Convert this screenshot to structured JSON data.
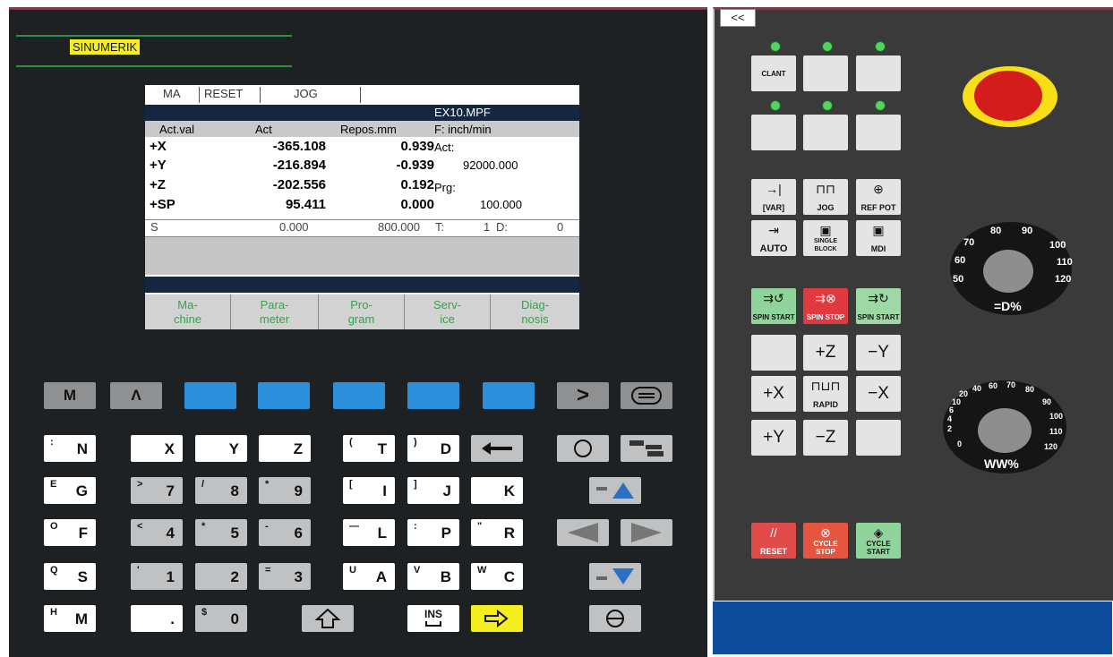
{
  "brand": "SINUMERIK",
  "screen": {
    "status": {
      "area": "MA",
      "channel": "RESET",
      "mode": "JOG"
    },
    "program_name": "EX10.MPF",
    "headers": {
      "col1": "Act.val",
      "col2": "Act",
      "col3": "Repos.mm",
      "col4": "F: inch/min"
    },
    "axes": [
      {
        "name": "+X",
        "act": "-365.108",
        "repos": "0.939"
      },
      {
        "name": "+Y",
        "act": "-216.894",
        "repos": "-0.939"
      },
      {
        "name": "+Z",
        "act": "-202.556",
        "repos": "0.192"
      },
      {
        "name": "+SP",
        "act": "95.411",
        "repos": "0.000"
      }
    ],
    "feed": {
      "act_label": "Act:",
      "act_value": "92000.000",
      "prg_label": "Prg:",
      "prg_value": "100.000"
    },
    "spindle_row": {
      "label": "S",
      "act": "0.000",
      "set": "800.000",
      "tool_label": "T:",
      "tool": "1",
      "d_label": "D:",
      "d": "0"
    },
    "softkeys": [
      {
        "line1": "Ma-",
        "line2": "chine"
      },
      {
        "line1": "Para-",
        "line2": "meter"
      },
      {
        "line1": "Pro-",
        "line2": "gram"
      },
      {
        "line1": "Serv-",
        "line2": "ice"
      },
      {
        "line1": "Diag-",
        "line2": "nosis"
      }
    ]
  },
  "keyboard": {
    "top_row": {
      "m": "M",
      "caret": "Λ",
      "next": ">"
    },
    "rows": [
      [
        {
          "sup": ":",
          "main": "N"
        },
        {
          "sup": "",
          "main": "X"
        },
        {
          "sup": "",
          "main": "Y"
        },
        {
          "sup": "",
          "main": "Z"
        },
        {
          "sup": "(",
          "main": "T"
        },
        {
          "sup": ")",
          "main": "D"
        }
      ],
      [
        {
          "sup": "E",
          "main": "G"
        },
        {
          "sup": ">",
          "main": "7"
        },
        {
          "sup": "/",
          "main": "8"
        },
        {
          "sup": "*",
          "main": "9"
        },
        {
          "sup": "[",
          "main": "I"
        },
        {
          "sup": "]",
          "main": "J"
        },
        {
          "sup": "",
          "main": "K"
        }
      ],
      [
        {
          "sup": "O",
          "main": "F"
        },
        {
          "sup": "<",
          "main": "4"
        },
        {
          "sup": "*",
          "main": "5"
        },
        {
          "sup": "-",
          "main": "6"
        },
        {
          "sup": "—",
          "main": "L"
        },
        {
          "sup": ":",
          "main": "P"
        },
        {
          "sup": "\"",
          "main": "R"
        }
      ],
      [
        {
          "sup": "Q",
          "main": "S"
        },
        {
          "sup": "'",
          "main": "1"
        },
        {
          "sup": "",
          "main": "2"
        },
        {
          "sup": "=",
          "main": "3"
        },
        {
          "sup": "U",
          "main": "A"
        },
        {
          "sup": "V",
          "main": "B"
        },
        {
          "sup": "W",
          "main": "C"
        }
      ],
      [
        {
          "sup": "H",
          "main": "M"
        },
        {
          "sup": "",
          "main": "."
        },
        {
          "sup": "$",
          "main": "0"
        }
      ]
    ],
    "ins_label": "INS"
  },
  "machine_panel": {
    "collapse_label": "<<",
    "clant_label": "CLANT",
    "mode_keys": {
      "var": "[VAR]",
      "jog": "JOG",
      "ref": "REF POT",
      "auto": "AUTO",
      "single": "SINGLE BLOCK",
      "mdi": "MDI"
    },
    "spindle_keys": {
      "start_left": "SPIN START",
      "stop": "SPIN STOP",
      "start_right": "SPIN START"
    },
    "axis_keys": {
      "pz": "+Z",
      "my": "−Y",
      "px": "+X",
      "rapid": "RAPID",
      "mx": "−X",
      "py": "+Y",
      "mz": "−Z"
    },
    "cycle_keys": {
      "reset": "RESET",
      "stop": "CYCLE STOP",
      "start": "CYCLE START"
    },
    "spindle_dial": {
      "ticks": [
        "50",
        "60",
        "70",
        "80",
        "90",
        "100",
        "110",
        "120"
      ],
      "label": "=D%"
    },
    "feed_dial": {
      "ticks": [
        "0",
        "2",
        "4",
        "6",
        "10",
        "20",
        "40",
        "60",
        "70",
        "80",
        "90",
        "100",
        "110",
        "120"
      ],
      "label": "WW%"
    },
    "colors": {
      "led": "#54d35f",
      "estop": "#d51c1c",
      "estop_ring": "#f7de16",
      "bottom_bar": "#0d4d9b"
    }
  }
}
